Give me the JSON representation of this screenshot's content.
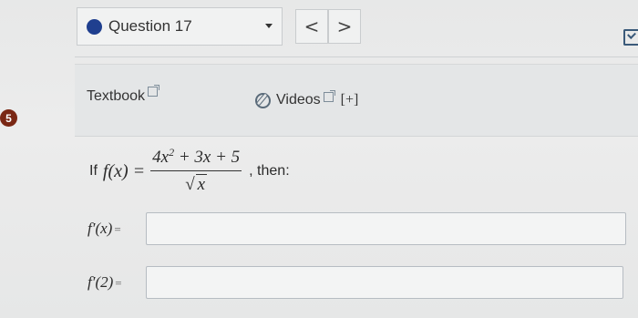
{
  "question": {
    "label": "Question 17",
    "prev_glyph": "<",
    "next_glyph": ">"
  },
  "badge": "5",
  "resources": {
    "textbook_label": "Textbook",
    "videos_label": "Videos",
    "plus_label": "[+]"
  },
  "problem": {
    "prefix": "If",
    "function": "f(x) =",
    "numerator_a": "4x",
    "numerator_exp": "2",
    "numerator_b": " + 3x + 5",
    "denominator_sqrt": "x",
    "suffix": ", then:"
  },
  "answers": [
    {
      "label": "f′(x)",
      "equals": "=",
      "value": ""
    },
    {
      "label": "f′(2)",
      "equals": "=",
      "value": ""
    }
  ],
  "colors": {
    "question_dot": "#1f3f8f",
    "badge": "#7a2714"
  },
  "icons": [
    "chevron-down-icon",
    "chevron-left-icon",
    "chevron-right-icon",
    "external-link-icon",
    "paperclip-icon",
    "checkbox-icon"
  ]
}
